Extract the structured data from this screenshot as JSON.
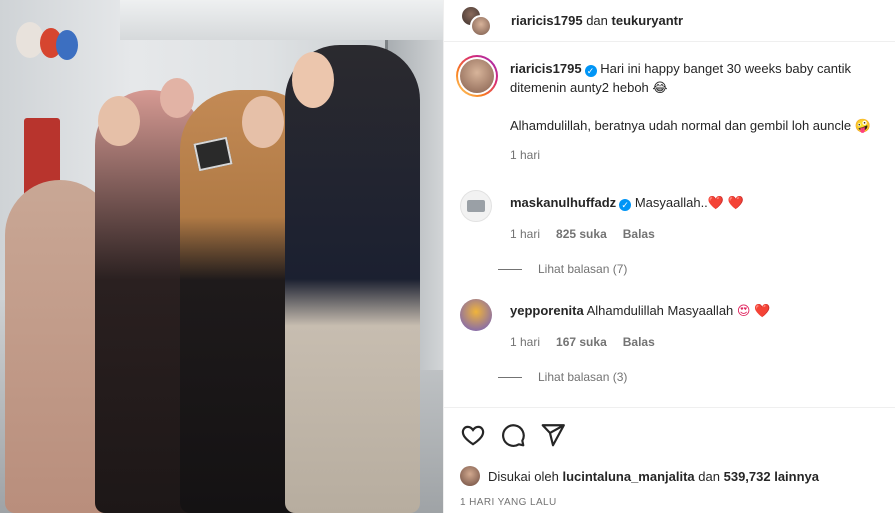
{
  "header": {
    "user1": "riaricis1795",
    "conjunction": "dan",
    "user2": "teukuryantr"
  },
  "caption": {
    "username": "riaricis1795",
    "verified_icon": "✓",
    "line1": "Hari ini happy banget 30 weeks baby cantik ditemenin aunty2 heboh 😂",
    "line2": "Alhamdulillah, beratnya udah normal dan gembil loh auncle 🤪",
    "time": "1 hari"
  },
  "comments": [
    {
      "username": "maskanulhuffadz",
      "verified": true,
      "verified_icon": "✓",
      "text": "Masyaallah..",
      "emoji": "❤️ ❤️",
      "time": "1 hari",
      "likes": "825 suka",
      "reply": "Balas",
      "view_replies": "Lihat balasan (7)"
    },
    {
      "username": "yepporenita",
      "verified": false,
      "text": "Alhamdulillah Masyaallah",
      "emoji": "😍 ❤️",
      "time": "1 hari",
      "likes": "167 suka",
      "reply": "Balas",
      "view_replies": "Lihat balasan (3)"
    }
  ],
  "actions": {
    "icons": [
      "heart-icon",
      "comment-icon",
      "share-icon"
    ]
  },
  "likes": {
    "prefix": "Disukai oleh",
    "user": "lucintaluna_manjalita",
    "middle": "dan",
    "count": "539,732 lainnya"
  },
  "timestamp": "1 HARI YANG LALU",
  "colors": {
    "verified": "#0095f6",
    "heart": "#e0245e",
    "text": "#262626",
    "muted": "#737373"
  }
}
